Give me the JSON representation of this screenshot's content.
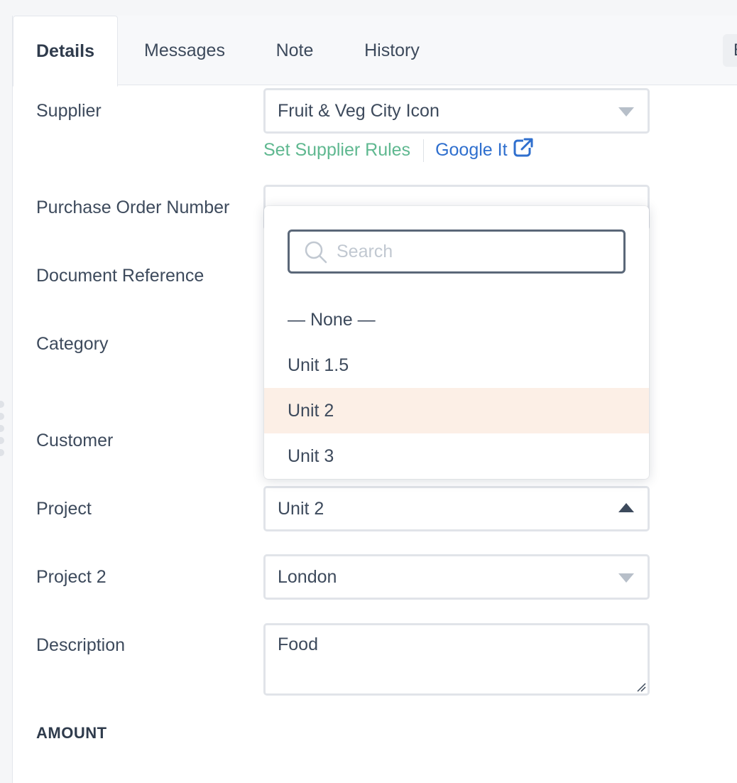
{
  "tabs": [
    {
      "label": "Details",
      "active": true
    },
    {
      "label": "Messages"
    },
    {
      "label": "Note"
    },
    {
      "label": "History"
    }
  ],
  "tab_right_button": "E",
  "form": {
    "supplier_label": "Supplier",
    "supplier_value": "Fruit & Veg City Icon",
    "set_rules_link": "Set Supplier Rules",
    "google_link": "Google It",
    "po_label": "Purchase Order Number",
    "doc_ref_label": "Document Reference",
    "category_label": "Category",
    "customer_label": "Customer",
    "project_label": "Project",
    "project_value": "Unit 2",
    "project2_label": "Project 2",
    "project2_value": "London",
    "description_label": "Description",
    "description_value": "Food",
    "amount_heading": "AMOUNT"
  },
  "dropdown": {
    "search_placeholder": "Search",
    "options": [
      {
        "label": "— None —"
      },
      {
        "label": "Unit 1.5"
      },
      {
        "label": "Unit 2",
        "highlighted": true
      },
      {
        "label": "Unit 3"
      }
    ]
  },
  "colors": {
    "link_green": "#5fb890",
    "link_blue": "#2f6fce",
    "highlight": "#fcefe6"
  }
}
